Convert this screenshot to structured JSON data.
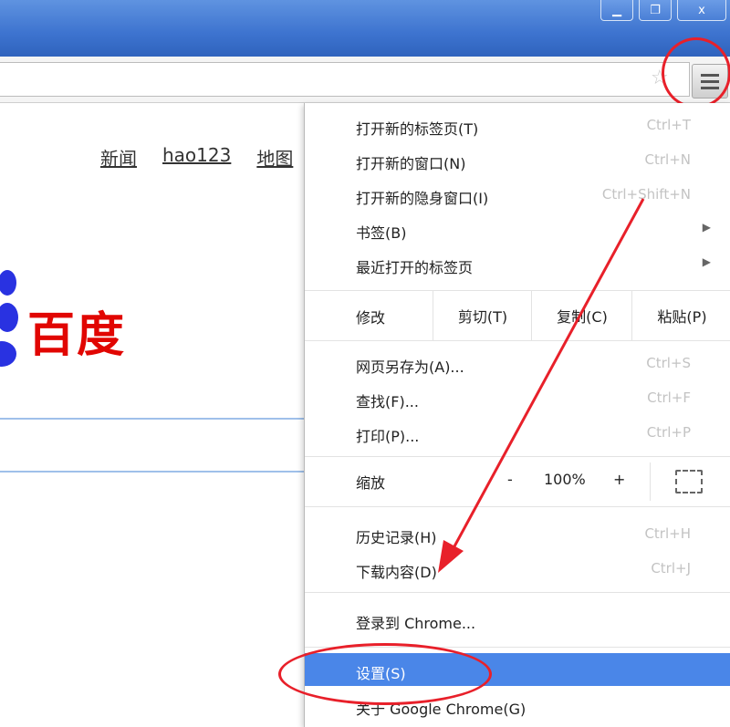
{
  "window": {
    "minimize_icon": "minimize-icon",
    "restore_icon": "restore-icon",
    "close_label": "x"
  },
  "toolbar": {
    "star_icon": "bookmark-star-icon",
    "menu_icon": "hamburger-menu-icon"
  },
  "page": {
    "nav_links": [
      "新闻",
      "hao123",
      "地图"
    ],
    "logo_text": "百度"
  },
  "menu": {
    "new_tab": {
      "label": "打开新的标签页(T)",
      "shortcut": "Ctrl+T"
    },
    "new_window": {
      "label": "打开新的窗口(N)",
      "shortcut": "Ctrl+N"
    },
    "new_incognito": {
      "label": "打开新的隐身窗口(I)",
      "shortcut": "Ctrl+Shift+N"
    },
    "bookmarks": {
      "label": "书签(B)"
    },
    "recent_tabs": {
      "label": "最近打开的标签页"
    },
    "edit": {
      "label": "修改",
      "cut": "剪切(T)",
      "copy": "复制(C)",
      "paste": "粘贴(P)"
    },
    "save_as": {
      "label": "网页另存为(A)...",
      "shortcut": "Ctrl+S"
    },
    "find": {
      "label": "查找(F)...",
      "shortcut": "Ctrl+F"
    },
    "print": {
      "label": "打印(P)...",
      "shortcut": "Ctrl+P"
    },
    "zoom": {
      "label": "缩放",
      "minus": "-",
      "level": "100%",
      "plus": "+"
    },
    "history": {
      "label": "历史记录(H)",
      "shortcut": "Ctrl+H"
    },
    "downloads": {
      "label": "下载内容(D)",
      "shortcut": "Ctrl+J"
    },
    "signin": {
      "label": "登录到 Chrome..."
    },
    "settings": {
      "label": "设置(S)"
    },
    "about": {
      "label": "关于 Google Chrome(G)"
    }
  },
  "colors": {
    "highlight": "#4a86e8",
    "annotation": "#e8202a",
    "titlebar": "#3d73cf",
    "logo_red": "#e10602",
    "logo_blue": "#2932e1"
  }
}
